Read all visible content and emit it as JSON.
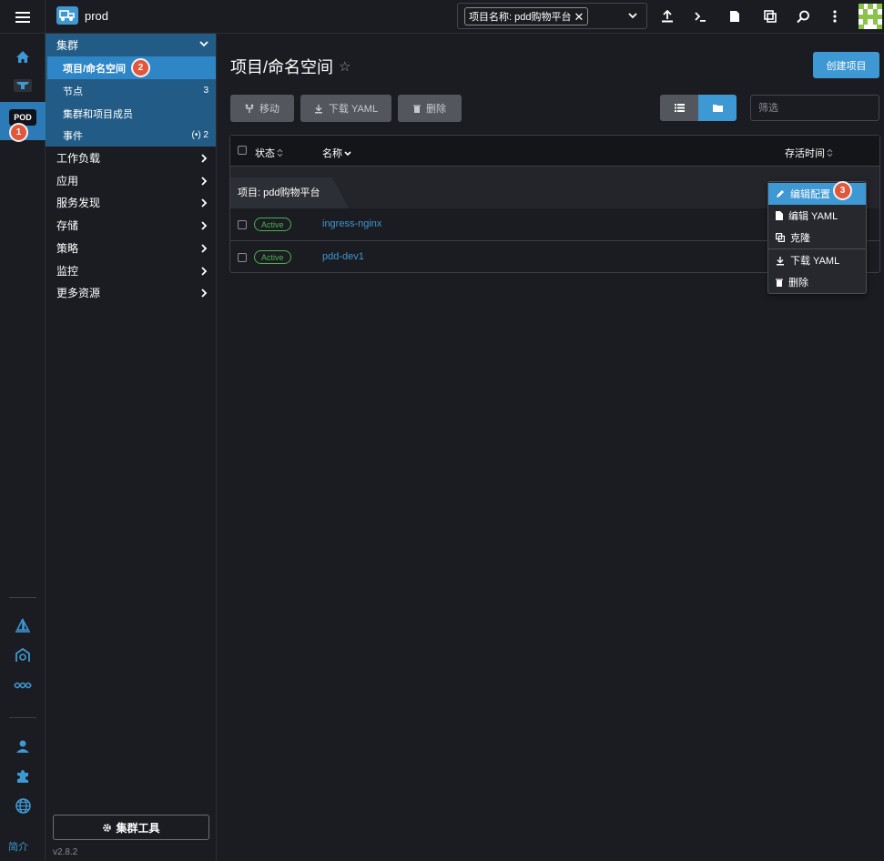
{
  "topbar": {
    "cluster_name": "prod",
    "namespace_chip": "项目名称: pdd购物平台",
    "icons": [
      "import-yaml-icon",
      "kubectl-shell-icon",
      "kubeconfig-icon",
      "copy-kubeconfig-icon",
      "search-icon",
      "more-icon"
    ]
  },
  "rail": {
    "pod_label": "POD",
    "about_label": "简介"
  },
  "sidemenu": {
    "group_label": "集群",
    "sub_items": [
      {
        "label": "项目/命名空间",
        "count": ""
      },
      {
        "label": "节点",
        "count": "3"
      },
      {
        "label": "集群和项目成员",
        "count": ""
      },
      {
        "label": "事件",
        "count": "(•) 2"
      }
    ],
    "items": [
      "工作负载",
      "应用",
      "服务发现",
      "存储",
      "策略",
      "监控",
      "更多资源"
    ],
    "cluster_tools_label": "集群工具",
    "version": "v2.8.2"
  },
  "main": {
    "title": "项目/命名空间",
    "create_label": "创建项目",
    "toolbar": {
      "move_label": "移动",
      "download_label": "下载 YAML",
      "delete_label": "删除"
    },
    "filter_placeholder": "筛选",
    "table": {
      "col_status": "状态",
      "col_name": "名称",
      "col_age": "存活时间",
      "group_label": "项目: pdd购物平台",
      "rows": [
        {
          "status": "Active",
          "name": "ingress-nginx"
        },
        {
          "status": "Active",
          "name": "pdd-dev1"
        }
      ]
    }
  },
  "context_menu": {
    "items": [
      {
        "label": "编辑配置",
        "icon": "pencil-icon"
      },
      {
        "label": "编辑 YAML",
        "icon": "file-icon"
      },
      {
        "label": "克隆",
        "icon": "copy-icon"
      },
      {
        "label": "下载 YAML",
        "icon": "download-icon"
      },
      {
        "label": "删除",
        "icon": "trash-icon"
      }
    ]
  },
  "badges": [
    "1",
    "2",
    "3"
  ],
  "colors": {
    "accent": "#3d98d3",
    "group_bg": "#225c86",
    "active_item": "#2f86c6",
    "status_active": "#4caf50",
    "badge": "#e0573c"
  }
}
